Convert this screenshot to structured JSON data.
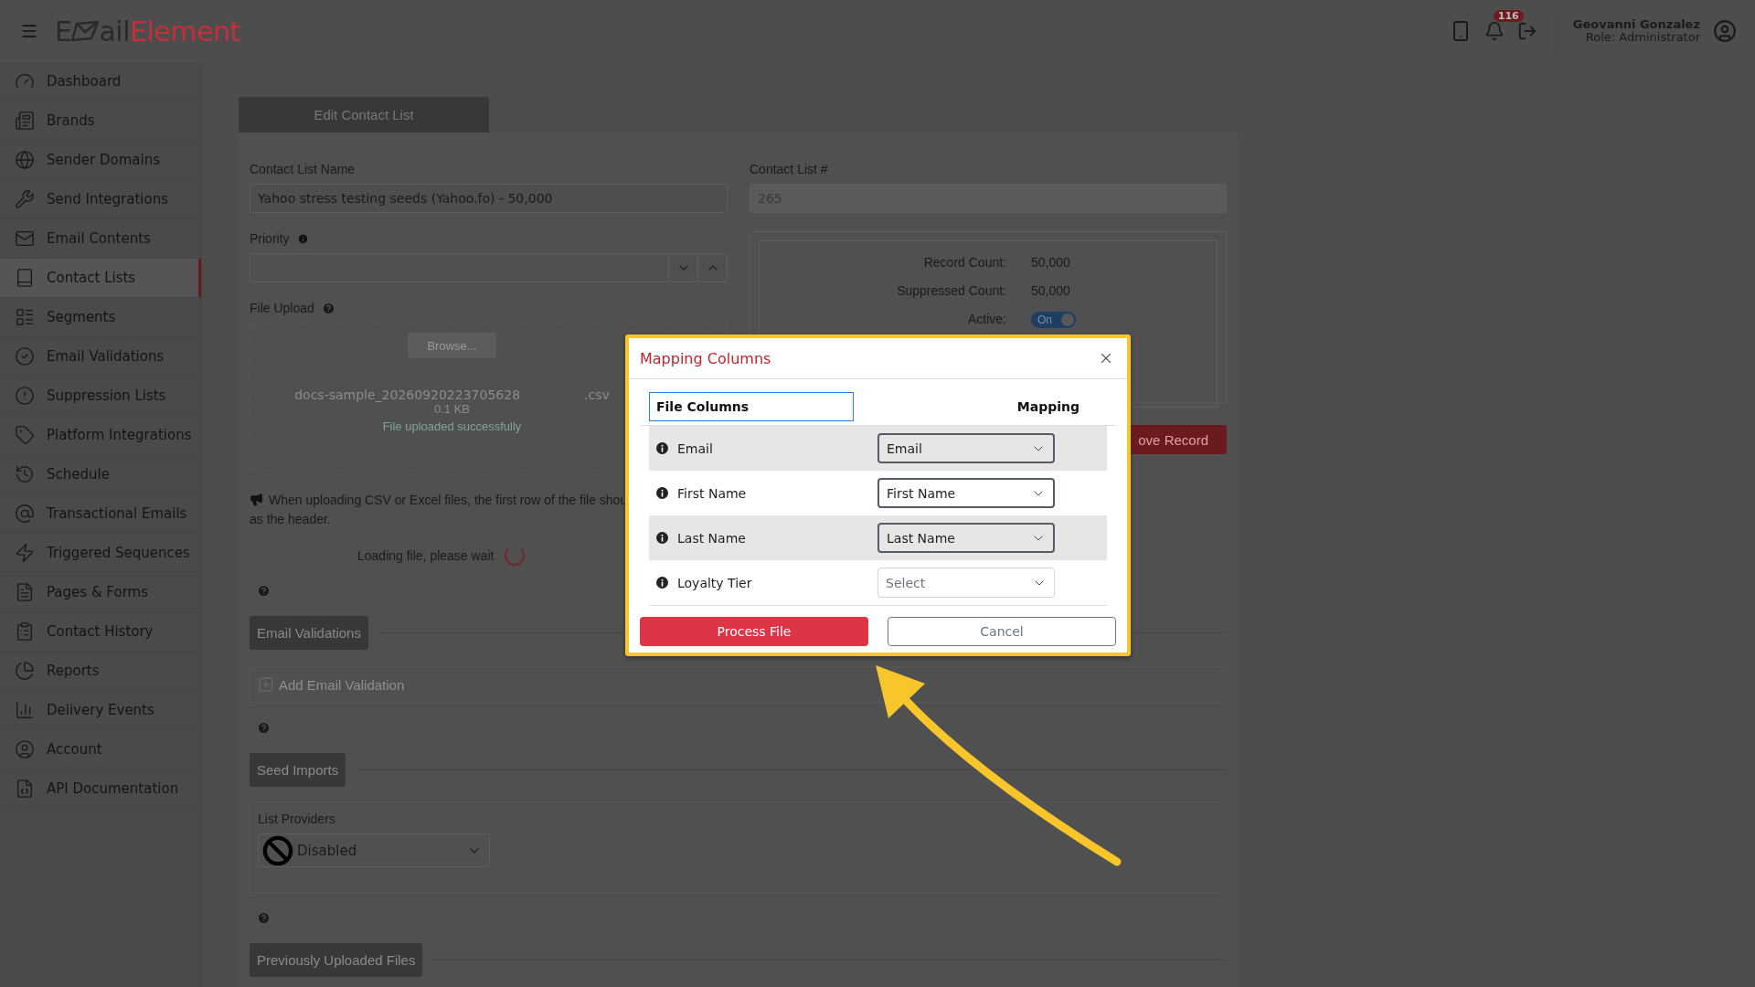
{
  "header": {
    "logo": {
      "part_1": "E",
      "part_2": "ail",
      "part_3": "Element"
    },
    "notification_count": "116",
    "user": {
      "name": "Geovanni Gonzalez",
      "role": "Role: Administrator"
    }
  },
  "sidebar": {
    "items": [
      {
        "label": "Dashboard",
        "selected": false
      },
      {
        "label": "Brands",
        "selected": false
      },
      {
        "label": "Sender Domains",
        "selected": false
      },
      {
        "label": "Send Integrations",
        "selected": false
      },
      {
        "label": "Email Contents",
        "selected": false
      },
      {
        "label": "Contact Lists",
        "selected": true
      },
      {
        "label": "Segments",
        "selected": false
      },
      {
        "label": "Email Validations",
        "selected": false
      },
      {
        "label": "Suppression Lists",
        "selected": false
      },
      {
        "label": "Platform Integrations",
        "selected": false
      },
      {
        "label": "Schedule",
        "selected": false
      },
      {
        "label": "Transactional Emails",
        "selected": false
      },
      {
        "label": "Triggered Sequences",
        "selected": false
      },
      {
        "label": "Pages & Forms",
        "selected": false
      },
      {
        "label": "Contact History",
        "selected": false
      },
      {
        "label": "Reports",
        "selected": false
      },
      {
        "label": "Delivery Events",
        "selected": false
      },
      {
        "label": "Account",
        "selected": false
      },
      {
        "label": "API Documentation",
        "selected": false
      }
    ]
  },
  "tab": {
    "label": "Edit Contact List"
  },
  "form": {
    "name_label": "Contact List Name",
    "name_value": "Yahoo stress testing seeds (Yahoo.fo) - 50,000",
    "number_label": "Contact List #",
    "number_value": "265",
    "priority_label": "Priority",
    "upload_label": "File Upload",
    "upload": {
      "browse": "Browse...",
      "file_name": "docs-sample_20260920223705628",
      "file_ext": ".csv",
      "file_size": "0.1 KB",
      "status": "File uploaded successfully"
    },
    "stats": [
      {
        "label": "Record Count:",
        "value": "50,000"
      },
      {
        "label": "Suppressed Count:",
        "value": "50,000"
      }
    ],
    "active": {
      "label": "Active:",
      "toggle_text": "On",
      "on": true
    },
    "remove_button": "ove Record",
    "notice": {
      "line_1": "When uploading CSV or Excel files, the first row of the file shou",
      "line_2": "as the header."
    },
    "loading": "Loading file, please wait"
  },
  "sections": [
    {
      "title": "Email Validations",
      "kind": "add",
      "add_label": "Add Email Validation"
    },
    {
      "title": "Seed Imports",
      "kind": "providers",
      "providers_label": "List Providers",
      "providers_value": "Disabled"
    },
    {
      "title": "Previously Uploaded Files",
      "kind": "plain"
    }
  ],
  "modal": {
    "title": "Mapping Columns",
    "columns": [
      "File Columns",
      "Mapping"
    ],
    "rows": [
      {
        "name": "Email",
        "value": "Email"
      },
      {
        "name": "First Name",
        "value": "First Name"
      },
      {
        "name": "Last Name",
        "value": "Last Name"
      },
      {
        "name": "Loyalty Tier",
        "placeholder": "Select"
      }
    ],
    "buttons": [
      "Process File",
      "Cancel"
    ]
  }
}
